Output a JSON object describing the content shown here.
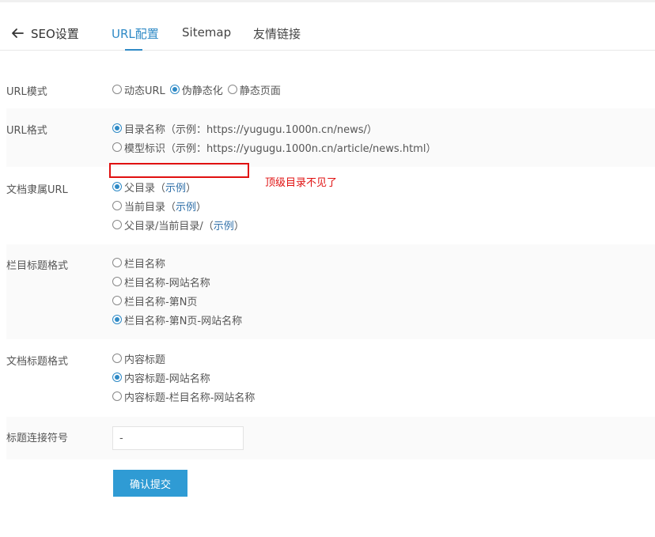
{
  "header": {
    "back_label": "SEO设置",
    "tabs": [
      {
        "label": "URL配置",
        "active": true
      },
      {
        "label": "Sitemap",
        "active": false
      },
      {
        "label": "友情链接",
        "active": false
      }
    ]
  },
  "form": {
    "url_mode": {
      "label": "URL模式",
      "options": [
        {
          "label": "动态URL",
          "checked": false
        },
        {
          "label": "伪静态化",
          "checked": true
        },
        {
          "label": "静态页面",
          "checked": false
        }
      ]
    },
    "url_format": {
      "label": "URL格式",
      "options": [
        {
          "label": "目录名称",
          "example_prefix": "（示例：",
          "example_url": "https://yugugu.1000n.cn/news/",
          "example_suffix": "）",
          "checked": true
        },
        {
          "label": "模型标识",
          "example_prefix": "（示例：",
          "example_url": "https://yugugu.1000n.cn/article/news.html",
          "example_suffix": "）",
          "checked": false
        }
      ]
    },
    "doc_url": {
      "label": "文档隶属URL",
      "options": [
        {
          "label": "父目录",
          "example_prefix": "（",
          "example_link": "示例",
          "example_suffix": "）",
          "checked": true
        },
        {
          "label": "当前目录",
          "example_prefix": "（",
          "example_link": "示例",
          "example_suffix": "）",
          "checked": false
        },
        {
          "label": "父目录/当前目录/",
          "example_prefix": "（",
          "example_link": "示例",
          "example_suffix": "）",
          "checked": false
        }
      ]
    },
    "column_title": {
      "label": "栏目标题格式",
      "options": [
        {
          "label": "栏目名称",
          "checked": false
        },
        {
          "label": "栏目名称-网站名称",
          "checked": false
        },
        {
          "label": "栏目名称-第N页",
          "checked": false
        },
        {
          "label": "栏目名称-第N页-网站名称",
          "checked": true
        }
      ]
    },
    "doc_title": {
      "label": "文档标题格式",
      "options": [
        {
          "label": "内容标题",
          "checked": false
        },
        {
          "label": "内容标题-网站名称",
          "checked": true
        },
        {
          "label": "内容标题-栏目名称-网站名称",
          "checked": false
        }
      ]
    },
    "title_separator": {
      "label": "标题连接符号",
      "value": "-"
    },
    "submit_label": "确认提交"
  },
  "annotation": {
    "text": "顶级目录不见了",
    "color": "#e01010"
  },
  "colors": {
    "accent": "#2f8ac6",
    "button": "#2f9bd4",
    "row_alt": "#fafafa"
  }
}
